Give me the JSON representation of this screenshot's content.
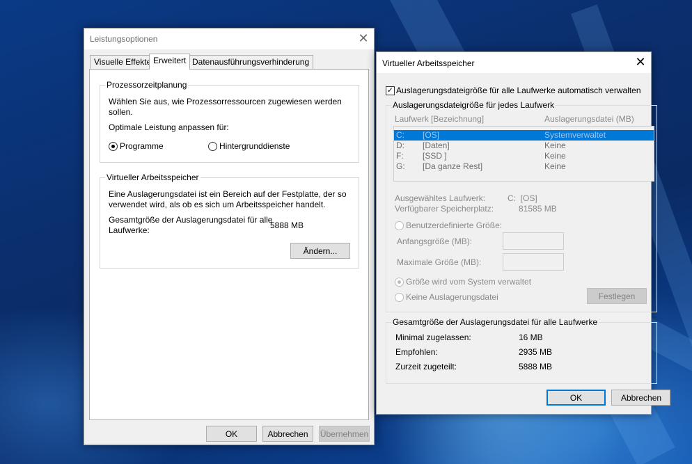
{
  "perf": {
    "title": "Leistungsoptionen",
    "tabs": [
      "Visuelle Effekte",
      "Erweitert",
      "Datenausführungsverhinderung"
    ],
    "processor": {
      "group_title": "Prozessorzeitplanung",
      "desc_line1": "Wählen Sie aus, wie Prozessorressourcen zugewiesen werden",
      "desc_line2": "sollen.",
      "optimize_label": "Optimale Leistung anpassen für:",
      "option_programs": "Programme",
      "option_services": "Hintergrunddienste"
    },
    "virtual": {
      "group_title": "Virtueller Arbeitsspeicher",
      "desc_line1": "Eine Auslagerungsdatei ist ein Bereich auf der Festplatte, der so",
      "desc_line2": "verwendet wird, als ob es sich um Arbeitsspeicher handelt.",
      "total_label_line1": "Gesamtgröße der Auslagerungsdatei für alle",
      "total_label_line2": "Laufwerke:",
      "total_value": "5888 MB",
      "change_button": "Ändern..."
    },
    "buttons": {
      "ok": "OK",
      "cancel": "Abbrechen",
      "apply": "Übernehmen"
    }
  },
  "vm": {
    "title": "Virtueller Arbeitsspeicher",
    "auto_manage_label": "Auslagerungsdateigröße für alle Laufwerke automatisch verwalten",
    "auto_manage_checked": true,
    "per_drive_title": "Auslagerungsdateigröße für jedes Laufwerk",
    "columns": [
      "Laufwerk [Bezeichnung]",
      "Auslagerungsdatei (MB)"
    ],
    "drives": [
      {
        "letter": "C:",
        "label": "[OS]",
        "paging": "Systemverwaltet",
        "selected": true
      },
      {
        "letter": "D:",
        "label": "[Daten]",
        "paging": "Keine",
        "selected": false
      },
      {
        "letter": "F:",
        "label": "[SSD ]",
        "paging": "Keine",
        "selected": false
      },
      {
        "letter": "G:",
        "label": "[Da ganze Rest]",
        "paging": "Keine",
        "selected": false
      }
    ],
    "selected_drive_label": "Ausgewähltes Laufwerk:",
    "selected_drive_value": "C:  [OS]",
    "free_space_label": "Verfügbarer Speicherplatz:",
    "free_space_value": "81585 MB",
    "custom_size_label": "Benutzerdefinierte Größe:",
    "initial_size_label": "Anfangsgröße (MB):",
    "max_size_label": "Maximale Größe (MB):",
    "system_managed_label": "Größe wird vom System verwaltet",
    "no_paging_label": "Keine Auslagerungsdatei",
    "set_button": "Festlegen",
    "totals_title": "Gesamtgröße der Auslagerungsdatei für alle Laufwerke",
    "min_label": "Minimal zugelassen:",
    "min_value": "16 MB",
    "recommended_label": "Empfohlen:",
    "recommended_value": "2935 MB",
    "allocated_label": "Zurzeit zugeteilt:",
    "allocated_value": "5888 MB",
    "ok_button": "OK",
    "cancel_button": "Abbrechen"
  }
}
